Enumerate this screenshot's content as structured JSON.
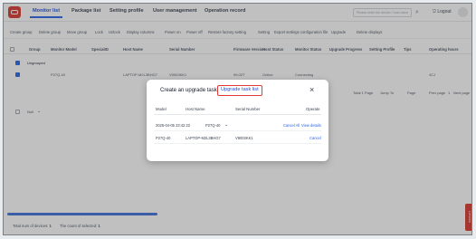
{
  "nav": {
    "tabs": [
      "Monitor list",
      "Package list",
      "Setting profile",
      "User management",
      "Operation record"
    ],
    "search_placeholder": "Please enter the device / host name",
    "logout_label": "Logout"
  },
  "toolbar": {
    "buttons": [
      "Create group",
      "Delete group",
      "Move group",
      "Lock",
      "Unlock",
      "Display columns",
      "Power on",
      "Power off",
      "Restore factory setting",
      "Setting",
      "Export settings configuration file",
      "Upgrade",
      "Delete displays"
    ]
  },
  "table": {
    "headers": [
      "Group",
      "Monitor Model",
      "SpecialID",
      "Host Name",
      "Serial Number",
      "Firmware Version",
      "Host Status",
      "Monitor Status",
      "Upgrade Progress",
      "Setting Profile",
      "Tips",
      "Operating hours"
    ],
    "group_label": "Ungrouped",
    "row": {
      "model": "P27Q-40",
      "host": "LAPTOP-M2L3BHG7",
      "serial": "V9003KK1",
      "firmware": "99.0ZT",
      "host_status": "Online",
      "monitor_status": "Connecting",
      "hours": "4CJ"
    },
    "pagination": [
      "Total 1 Page",
      "Jump To",
      "Page",
      "Prev page",
      "1",
      "Next page"
    ],
    "second_group_label": "Null"
  },
  "footer": {
    "total_label": "Total num of devices:",
    "total_value": "1",
    "selected_label": "The count of selected:",
    "selected_value": "1"
  },
  "side_tab": "Lenovo",
  "modal": {
    "title": "Create an upgrade task",
    "tab_link": "Upgrade task list",
    "headers": [
      "Model",
      "Host Name",
      "Serial Number",
      "Operate"
    ],
    "task": {
      "time": "2025-04-05 23:42:22",
      "model": "P27Q-40",
      "actions": [
        "Cancel All",
        "View details"
      ]
    },
    "device": {
      "model": "P27Q-40",
      "host": "LAPTOP-M2L3BHG7",
      "serial": "V9003KK1",
      "action": "Cancel"
    }
  },
  "colors": {
    "brand_red": "#d9352c",
    "accent_blue": "#2563eb",
    "highlight_border": "#e53935"
  }
}
